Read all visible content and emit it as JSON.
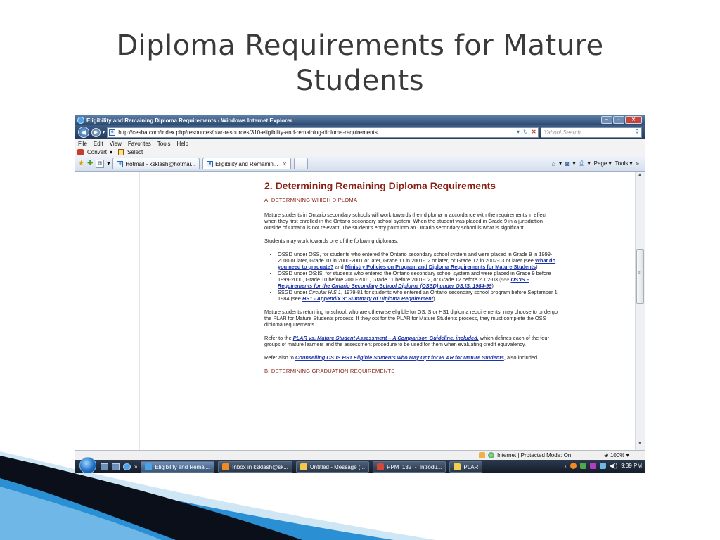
{
  "slide": {
    "title_line1": "Diploma Requirements for Mature",
    "title_line2": "Students"
  },
  "colors": {
    "heading": "#8a1f11",
    "link": "#1d33a8",
    "swoosh_dark": "#0b0f1a",
    "swoosh_light": "#2b8fd4"
  },
  "window": {
    "title": "Eligibility and Remaining Diploma Requirements - Windows Internet Explorer",
    "buttons": {
      "minimize": "–",
      "maximize": "▫",
      "close": "✕"
    }
  },
  "address": {
    "back": "◀",
    "forward": "▶",
    "dropdown": "▾",
    "url": "http://cesba.com/index.php/resources/plar-resources/310-eligibility-and-remaining-diploma-requirements",
    "refresh": "↻",
    "stop": "✕",
    "search_placeholder": "Yahoo! Search",
    "search_icon": "⚲"
  },
  "menu": [
    "File",
    "Edit",
    "View",
    "Favorites",
    "Tools",
    "Help"
  ],
  "command": {
    "convert": "Convert",
    "convert_arrow": "▾",
    "select": "Select"
  },
  "tabs": {
    "favorites_star": "★",
    "add_favorite": "✚",
    "grid": "⊞",
    "grid_arrow": "▾",
    "items": [
      {
        "label": "Hotmail - ksklash@hotmai..."
      },
      {
        "label": "Eligibility and Remainin...",
        "close": "✕"
      }
    ],
    "tools": {
      "home": "⌂",
      "feeds": "◙",
      "print": "⎙",
      "arrow": "▾",
      "page": "Page",
      "tools": "Tools",
      "more": "»"
    }
  },
  "article": {
    "heading": "2.  Determining Remaining Diploma Requirements",
    "section_a": "A:  DETERMINING WHICH DIPLOMA",
    "p1": "Mature students in Ontario secondary schools will work towards their diploma in accordance with the requirements in effect when they first enrolled in the Ontario secondary school system. When the student was placed in Grade 9 in a jurisdiction outside of Ontario is not relevant.  The student’s entry point into an Ontario secondary school is what is significant.",
    "p2": "Students may work towards one of the following diplomas:",
    "bullets": {
      "b1_text": "OSSD under OSS, for students who entered the Ontario secondary school system and were placed in Grade 9 in 1999-2000 or later, Grade 10 in 2000-2001 or later, Grade 11 in 2001-02 or later, or Grade 12 in 2002-03 or later (see ",
      "b1_link1": "What do you need to graduate?",
      "b1_and": " and ",
      "b1_link2": "Ministry Policies on Program and Diploma Requirements for Mature Students",
      "b1_close": ")",
      "b2_text": "OSSD under OS:IS, for students who entered the Ontario secondary school system and were placed in Grade 9 before 1999-2000, Grade 10 before 2000-2001, Grade 11 before 2001-02, or Grade 12 before 2002-03 ",
      "b2_see": "(see ",
      "b2_link": "OS:IS – Requirements for the Ontario Secondary School Diploma (OSSD) under OS:IS, 1984-99",
      "b2_close": ")",
      "b3_text1": "SSGD under ",
      "b3_ital": "Circular H.S.1",
      "b3_text2": ", 1979-81 for students who entered an Ontario secondary school program before September 1, 1984 (see ",
      "b3_link": "HS1 - Appendix 3: Summary of Diploma Requirement",
      "b3_close": ")"
    },
    "p3": "Mature students returning to school, who are otherwise eligible for OS:IS or HS1 diploma requirements, may choose to undergo the PLAR for Mature Students process.  If they opt for the PLAR for Mature Students process, they must complete the OSS diploma requirements.",
    "p4_pre": "Refer to the ",
    "p4_link": "PLAR vs. Mature Student Assessment – A Comparison Guideline, included.",
    "p4_post": "  which defines each of the four groups of mature learners and the assessment procedure to be used for them when evaluating credit equivalency.",
    "p5_pre": "Refer also to ",
    "p5_link": "Counselling OS:IS HS1 Eligible Students who May Opt for PLAR for Mature Students",
    "p5_post": ", also included.",
    "section_b": "B:  DETERMINING GRADUATION REQUIREMENTS"
  },
  "scroll": {
    "up": "▲",
    "down": "▼",
    "grip": "≡"
  },
  "status": {
    "zone": "Internet | Protected Mode: On",
    "zoom": "100%",
    "zoom_arrow": "▾"
  },
  "taskbar": {
    "chevron": "»",
    "items": [
      {
        "label": "Eligibility and Remai...",
        "color": "#4aa2e8"
      },
      {
        "label": "Inbox in ksklash@sk...",
        "color": "#f08a24"
      },
      {
        "label": "Untitled - Message (...",
        "color": "#f4c84a"
      },
      {
        "label": "PPM_132_-_Introdu...",
        "color": "#d1473a"
      },
      {
        "label": "PLAR",
        "color": "#f2d04a"
      }
    ],
    "tray_arrow": "‹",
    "volume": "◀))",
    "time": "9:39 PM"
  }
}
